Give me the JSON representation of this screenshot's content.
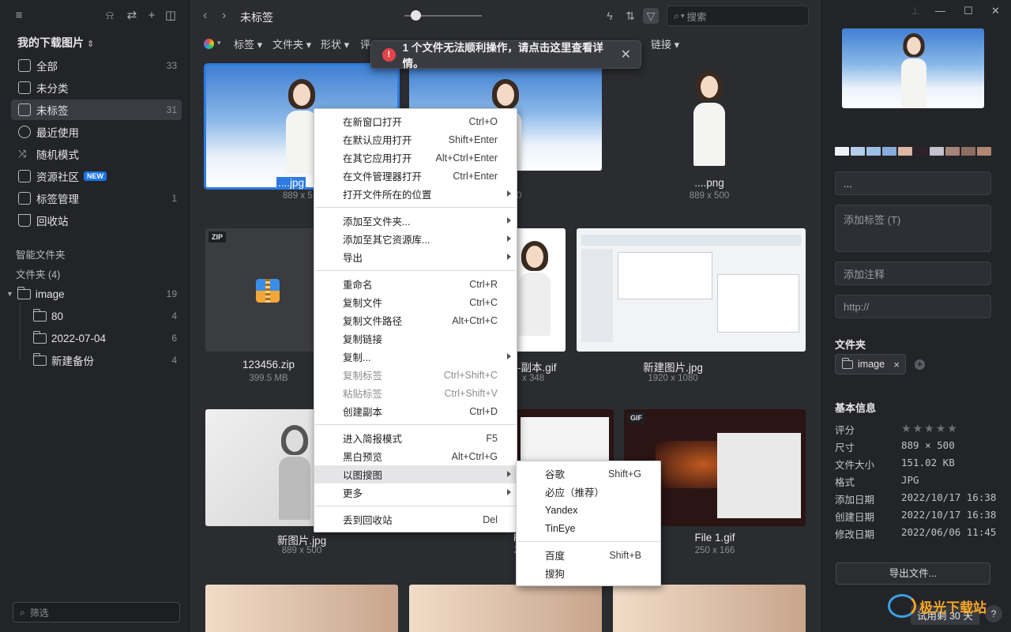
{
  "sidebar": {
    "library_title": "我的下载图片",
    "items": [
      {
        "label": "全部",
        "count": "33"
      },
      {
        "label": "未分类",
        "count": ""
      },
      {
        "label": "未标签",
        "count": "31"
      },
      {
        "label": "最近使用",
        "count": ""
      },
      {
        "label": "随机模式",
        "count": ""
      },
      {
        "label": "资源社区",
        "count": "",
        "badge": "NEW"
      },
      {
        "label": "标签管理",
        "count": "1"
      },
      {
        "label": "回收站",
        "count": ""
      }
    ],
    "smart_folders_label": "智能文件夹",
    "folders_label": "文件夹 (4)",
    "tree": [
      {
        "label": "image",
        "count": "19"
      },
      {
        "label": "80",
        "count": "4"
      },
      {
        "label": "2022-07-04",
        "count": "6"
      },
      {
        "label": "新建备份",
        "count": "4"
      }
    ],
    "filter_placeholder": "筛选"
  },
  "toolbar": {
    "breadcrumb": "未标签",
    "search_placeholder": "搜索",
    "filters": [
      "标签",
      "文件夹",
      "形状",
      "评",
      "链接"
    ]
  },
  "toast": {
    "message": "1 个文件无法顺利操作，请点击这里查看详情。"
  },
  "grid": {
    "tiles": [
      {
        "name": "....jpg",
        "meta": "889 x 5"
      },
      {
        "name": "",
        "meta": "0"
      },
      {
        "name": "....png",
        "meta": "889 x 500"
      },
      {
        "name": "123456.zip",
        "meta": "399.5 MB",
        "ext": "ZIP"
      },
      {
        "name": "-副本.gif",
        "meta": "x 348"
      },
      {
        "name": "新建图片.jpg",
        "meta": "1920 x 1080"
      },
      {
        "name": "新图片.jpg",
        "meta": "889 x 500"
      },
      {
        "name": "Fil",
        "meta": "25"
      },
      {
        "name": "File 1.gif",
        "meta": "250 x 166",
        "ext": "GIF"
      }
    ]
  },
  "context_menu": {
    "groups": [
      [
        {
          "label": "在新窗口打开",
          "shortcut": "Ctrl+O"
        },
        {
          "label": "在默认应用打开",
          "shortcut": "Shift+Enter"
        },
        {
          "label": "在其它应用打开",
          "shortcut": "Alt+Ctrl+Enter"
        },
        {
          "label": "在文件管理器打开",
          "shortcut": "Ctrl+Enter"
        },
        {
          "label": "打开文件所在的位置",
          "shortcut": "",
          "submenu": true
        }
      ],
      [
        {
          "label": "添加至文件夹...",
          "shortcut": "",
          "submenu": true
        },
        {
          "label": "添加至其它资源库...",
          "shortcut": "",
          "submenu": true
        },
        {
          "label": "导出",
          "shortcut": "",
          "submenu": true
        }
      ],
      [
        {
          "label": "重命名",
          "shortcut": "Ctrl+R"
        },
        {
          "label": "复制文件",
          "shortcut": "Ctrl+C"
        },
        {
          "label": "复制文件路径",
          "shortcut": "Alt+Ctrl+C"
        },
        {
          "label": "复制链接",
          "shortcut": ""
        },
        {
          "label": "复制...",
          "shortcut": "",
          "submenu": true
        },
        {
          "label": "复制标签",
          "shortcut": "Ctrl+Shift+C",
          "disabled": true
        },
        {
          "label": "粘贴标签",
          "shortcut": "Ctrl+Shift+V",
          "disabled": true
        },
        {
          "label": "创建副本",
          "shortcut": "Ctrl+D"
        }
      ],
      [
        {
          "label": "进入简报模式",
          "shortcut": "F5"
        },
        {
          "label": "黑白预览",
          "shortcut": "Alt+Ctrl+G"
        },
        {
          "label": "以图搜图",
          "shortcut": "",
          "submenu": true,
          "highlight": true
        },
        {
          "label": "更多",
          "shortcut": "",
          "submenu": true
        }
      ],
      [
        {
          "label": "丢到回收站",
          "shortcut": "Del"
        }
      ]
    ]
  },
  "submenu": {
    "groups": [
      [
        {
          "label": "谷歌",
          "shortcut": "Shift+G"
        },
        {
          "label": "必应（推荐）",
          "shortcut": ""
        },
        {
          "label": "Yandex",
          "shortcut": ""
        },
        {
          "label": "TinEye",
          "shortcut": ""
        }
      ],
      [
        {
          "label": "百度",
          "shortcut": "Shift+B"
        },
        {
          "label": "搜狗",
          "shortcut": ""
        }
      ]
    ]
  },
  "inspector": {
    "palette": [
      "#eef2f8",
      "#b3cdea",
      "#9ec0e6",
      "#86acdc",
      "#dcb7a4",
      "#2e2228",
      "#c5c0cc",
      "#a68478",
      "#8e6d62",
      "#b08872"
    ],
    "name_value": "...",
    "tags_placeholder": "添加标签 (T)",
    "note_placeholder": "添加注释",
    "url_placeholder": "http://",
    "folder_section": "文件夹",
    "folder_chip": "image",
    "basic_info_title": "基本信息",
    "info": [
      {
        "key": "评分",
        "value": ""
      },
      {
        "key": "尺寸",
        "value": "889 × 500"
      },
      {
        "key": "文件大小",
        "value": "151.02 KB"
      },
      {
        "key": "格式",
        "value": "JPG"
      },
      {
        "key": "添加日期",
        "value": "2022/10/17 16:38"
      },
      {
        "key": "创建日期",
        "value": "2022/10/17 16:38"
      },
      {
        "key": "修改日期",
        "value": "2022/06/06 11:45"
      }
    ],
    "rating": 0,
    "export_label": "导出文件...",
    "trial_text": "试用剩 30 天",
    "help_label": "?",
    "watermark": "极光下载站"
  }
}
